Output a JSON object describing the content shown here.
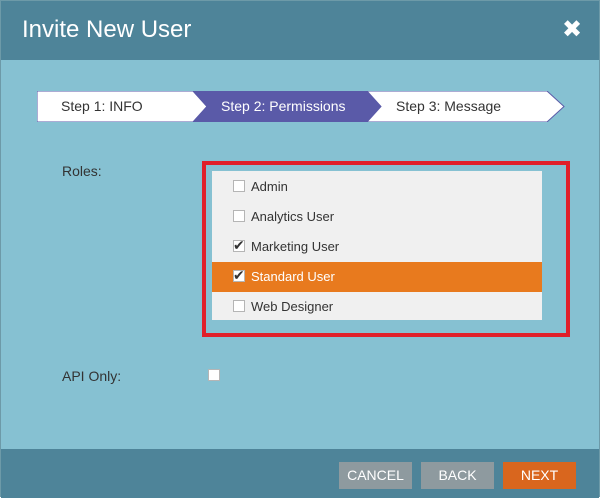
{
  "dialog": {
    "title": "Invite New User",
    "close_glyph": "✖"
  },
  "wizard": {
    "steps": [
      {
        "label": "Step 1: INFO",
        "active": false
      },
      {
        "label": "Step 2: Permissions",
        "active": true
      },
      {
        "label": "Step 3: Message",
        "active": false
      }
    ],
    "colors": {
      "active": "#5a5aa8",
      "inactive": "#ffffff"
    }
  },
  "roles": {
    "label": "Roles:",
    "items": [
      {
        "label": "Admin",
        "checked": false,
        "selected": false
      },
      {
        "label": "Analytics User",
        "checked": false,
        "selected": false
      },
      {
        "label": "Marketing User",
        "checked": true,
        "selected": false
      },
      {
        "label": "Standard User",
        "checked": true,
        "selected": true
      },
      {
        "label": "Web Designer",
        "checked": false,
        "selected": false
      }
    ],
    "highlight_color": "#e0202a",
    "selected_color": "#e87a1e"
  },
  "api_only": {
    "label": "API Only:",
    "checked": false
  },
  "footer": {
    "cancel_label": "CANCEL",
    "back_label": "BACK",
    "next_label": "NEXT"
  },
  "colors": {
    "titlebar": "#4e8499",
    "body": "#86c1d2",
    "next_button": "#d9661e",
    "grey_button": "#8e9a9f"
  }
}
